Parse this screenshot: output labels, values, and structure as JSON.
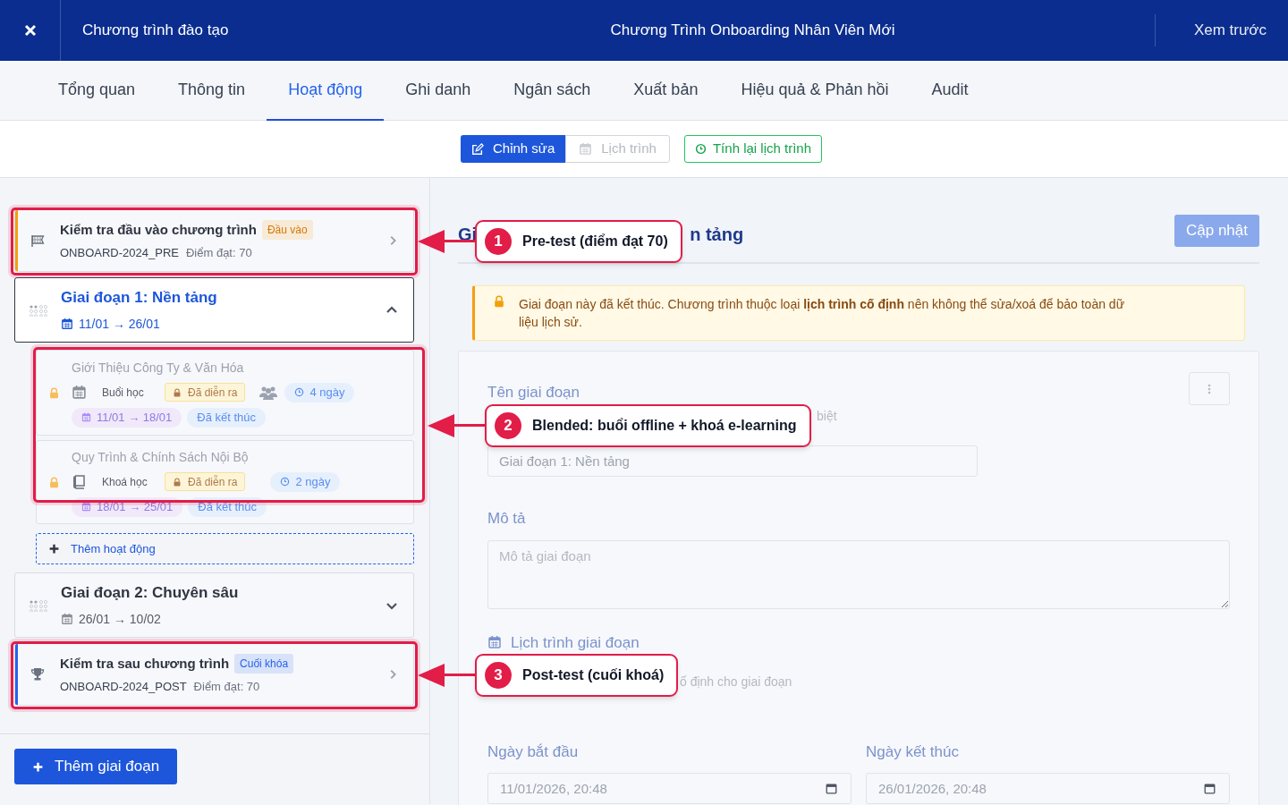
{
  "header": {
    "program_label": "Chương trình đào tạo",
    "title": "Chương Trình Onboarding Nhân Viên Mới",
    "preview_link": "Xem trước"
  },
  "tabs": [
    {
      "label": "Tổng quan",
      "selected": false
    },
    {
      "label": "Thông tin",
      "selected": false
    },
    {
      "label": "Hoạt động",
      "selected": true
    },
    {
      "label": "Ghi danh",
      "selected": false
    },
    {
      "label": "Ngân sách",
      "selected": false
    },
    {
      "label": "Xuất bản",
      "selected": false
    },
    {
      "label": "Hiệu quả & Phản hồi",
      "selected": false
    },
    {
      "label": "Audit",
      "selected": false
    }
  ],
  "toolbar": {
    "view_toggle": [
      {
        "label": "Chỉnh sửa",
        "selected": true
      },
      {
        "label": "Lịch trình",
        "selected": false
      }
    ],
    "recalc_button": "Tính lại lịch trình"
  },
  "sidebar": {
    "items": [
      {
        "kind": "pretest",
        "title": "Kiểm tra đầu vào chương trình",
        "badge": "Đầu vào",
        "color": "#f59e0b",
        "code": "ONBOARD-2024_PRE",
        "pass_score": "Điểm đạt: 70"
      },
      {
        "kind": "stage",
        "title": "Giai đoạn 1: Nền tảng",
        "dates": "11/01 → 26/01",
        "selected": true,
        "expanded": true,
        "activities": [
          {
            "kind": "session",
            "title": "Giới Thiệu Công Ty & Văn Hóa",
            "type_label": "Buổi học",
            "locked": true,
            "status": "Đã diễn ra",
            "duration": "4 ngày",
            "dates": "11/01 → 18/01",
            "end_status": "Đã kết thúc"
          },
          {
            "kind": "course",
            "title": "Quy Trình & Chính Sách Nội Bộ",
            "type_label": "Khoá học",
            "locked": true,
            "status": "Đã diễn ra",
            "duration": "2 ngày",
            "dates": "18/01 → 25/01",
            "end_status": "Đã kết thúc"
          }
        ],
        "add_activity": "Thêm hoạt động"
      },
      {
        "kind": "stage",
        "title": "Giai đoạn 2: Chuyên sâu",
        "dates": "26/01 → 10/02",
        "selected": false,
        "expanded": false
      },
      {
        "kind": "posttest",
        "title": "Kiểm tra sau chương trình",
        "badge": "Cuối khóa",
        "color": "#2563eb",
        "code": "ONBOARD-2024_POST",
        "pass_score": "Điểm đạt: 70"
      }
    ],
    "add_stage_button": "Thêm giai đoạn"
  },
  "detail": {
    "title_start": "Gi",
    "title_end": "n tảng",
    "update_button": "Cập nhật",
    "alert": "Giai đoạn này đã kết thúc. Chương trình thuộc loại **lịch trình cố định** nên không thể sửa/xoá để bảo toàn dữ liệu lịch sử.",
    "name_label": "Tên giai đoạn",
    "name_hint_end": "biệt",
    "name_value": "Giai đoạn 1: Nền tảng",
    "description_label": "Mô tả",
    "description_placeholder": "Mô tả giai đoạn",
    "schedule_heading": "Lịch trình giai đoạn",
    "schedule_hint_end": "ố định cho giai đoạn",
    "start_label": "Ngày bắt đầu",
    "start_value": "11/01/2026, 20:48",
    "end_label": "Ngày kết thúc",
    "end_value": "26/01/2026, 20:48"
  },
  "annotations": [
    {
      "number": "1",
      "text": "Pre-test (điểm đạt 70)"
    },
    {
      "number": "2",
      "text": "Blended: buổi offline + khoá e-learning"
    },
    {
      "number": "3",
      "text": "Post-test (cuối khoá)"
    }
  ]
}
